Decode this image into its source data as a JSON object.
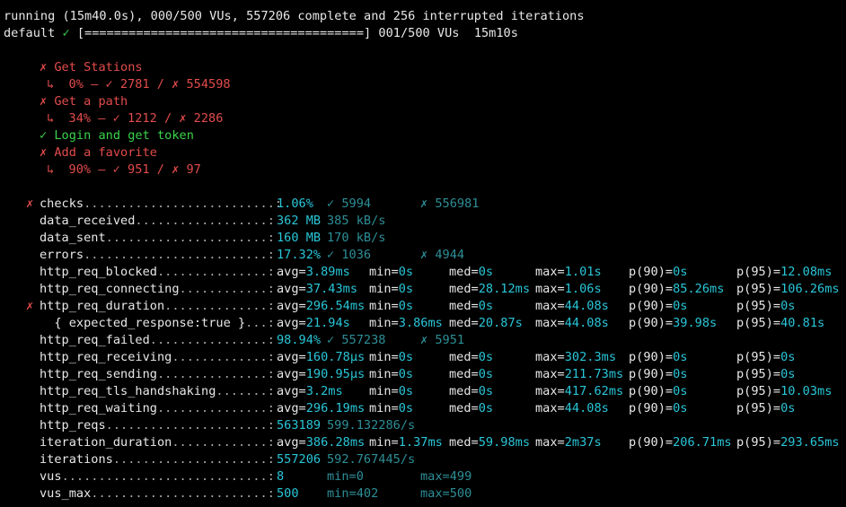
{
  "status": {
    "line1": "running (15m40.0s), 000/500 VUs, 557206 complete and 256 interrupted iterations",
    "scenario": "default",
    "check_mark": "✓",
    "bar_open": "[",
    "bar_fill": "======================================",
    "bar_close": "]",
    "progress_text": "001/500 VUs  15m10s"
  },
  "groups": [
    {
      "mark": "✗",
      "name": "Get Stations",
      "detail": "↳  0% — ✓ 2781 / ✗ 554598",
      "passed": false
    },
    {
      "mark": "✗",
      "name": "Get a path",
      "detail": "↳  34% — ✓ 1212 / ✗ 2286",
      "passed": false
    },
    {
      "mark": "✓",
      "name": "Login and get token",
      "detail": "",
      "passed": true
    },
    {
      "mark": "✗",
      "name": "Add a favorite",
      "detail": "↳  90% — ✓ 951 / ✗ 97",
      "passed": false
    }
  ],
  "metrics": [
    {
      "flag": "✗",
      "name": "checks",
      "dots": "..........................:",
      "main": "1.06%",
      "extra": [
        "✓ 5994",
        "✗ 556981"
      ]
    },
    {
      "flag": "",
      "name": "data_received",
      "dots": "..................:",
      "main": "362 MB",
      "extra": [
        "385 kB/s"
      ]
    },
    {
      "flag": "",
      "name": "data_sent",
      "dots": "......................:",
      "main": "160 MB",
      "extra": [
        "170 kB/s"
      ]
    },
    {
      "flag": "",
      "name": "errors",
      "dots": ".........................:",
      "main": "17.32%",
      "extra": [
        "✓ 1036",
        "✗ 4944"
      ]
    },
    {
      "flag": "",
      "name": "http_req_blocked",
      "dots": "...............:",
      "stats": [
        "avg=3.89ms",
        "min=0s",
        "med=0s",
        "max=1.01s",
        "p(90)=0s",
        "p(95)=12.08ms"
      ]
    },
    {
      "flag": "",
      "name": "http_req_connecting",
      "dots": "............:",
      "stats": [
        "avg=37.43ms",
        "min=0s",
        "med=28.12ms",
        "max=1.06s",
        "p(90)=85.26ms",
        "p(95)=106.26ms"
      ]
    },
    {
      "flag": "✗",
      "name": "http_req_duration",
      "dots": "..............:",
      "stats": [
        "avg=296.54ms",
        "min=0s",
        "med=0s",
        "max=44.08s",
        "p(90)=0s",
        "p(95)=0s"
      ]
    },
    {
      "flag": "",
      "name": "  { expected_response:true }",
      "dots": "...:",
      "stats": [
        "avg=21.94s",
        "min=3.86ms",
        "med=20.87s",
        "max=44.08s",
        "p(90)=39.98s",
        "p(95)=40.81s"
      ]
    },
    {
      "flag": "",
      "name": "http_req_failed",
      "dots": "................:",
      "main": "98.94%",
      "extra": [
        "✓ 557238",
        "✗ 5951"
      ]
    },
    {
      "flag": "",
      "name": "http_req_receiving",
      "dots": ".............:",
      "stats": [
        "avg=160.78µs",
        "min=0s",
        "med=0s",
        "max=302.3ms",
        "p(90)=0s",
        "p(95)=0s"
      ]
    },
    {
      "flag": "",
      "name": "http_req_sending",
      "dots": "...............:",
      "stats": [
        "avg=190.95µs",
        "min=0s",
        "med=0s",
        "max=211.73ms",
        "p(90)=0s",
        "p(95)=0s"
      ]
    },
    {
      "flag": "",
      "name": "http_req_tls_handshaking",
      "dots": ".......:",
      "stats": [
        "avg=3.2ms",
        "min=0s",
        "med=0s",
        "max=417.62ms",
        "p(90)=0s",
        "p(95)=10.03ms"
      ]
    },
    {
      "flag": "",
      "name": "http_req_waiting",
      "dots": "...............:",
      "stats": [
        "avg=296.19ms",
        "min=0s",
        "med=0s",
        "max=44.08s",
        "p(90)=0s",
        "p(95)=0s"
      ]
    },
    {
      "flag": "",
      "name": "http_reqs",
      "dots": "......................:",
      "main": "563189",
      "extra": [
        "599.132286/s"
      ]
    },
    {
      "flag": "",
      "name": "iteration_duration",
      "dots": ".............:",
      "stats": [
        "avg=386.28ms",
        "min=1.37ms",
        "med=59.98ms",
        "max=2m37s",
        "p(90)=206.71ms",
        "p(95)=293.65ms"
      ]
    },
    {
      "flag": "",
      "name": "iterations",
      "dots": ".....................:",
      "main": "557206",
      "extra": [
        "592.767445/s"
      ]
    },
    {
      "flag": "",
      "name": "vus",
      "dots": "............................:",
      "main": "8",
      "extra": [
        "min=0",
        "max=499"
      ]
    },
    {
      "flag": "",
      "name": "vus_max",
      "dots": "........................:",
      "main": "500",
      "extra": [
        "min=402",
        "max=500"
      ]
    }
  ]
}
